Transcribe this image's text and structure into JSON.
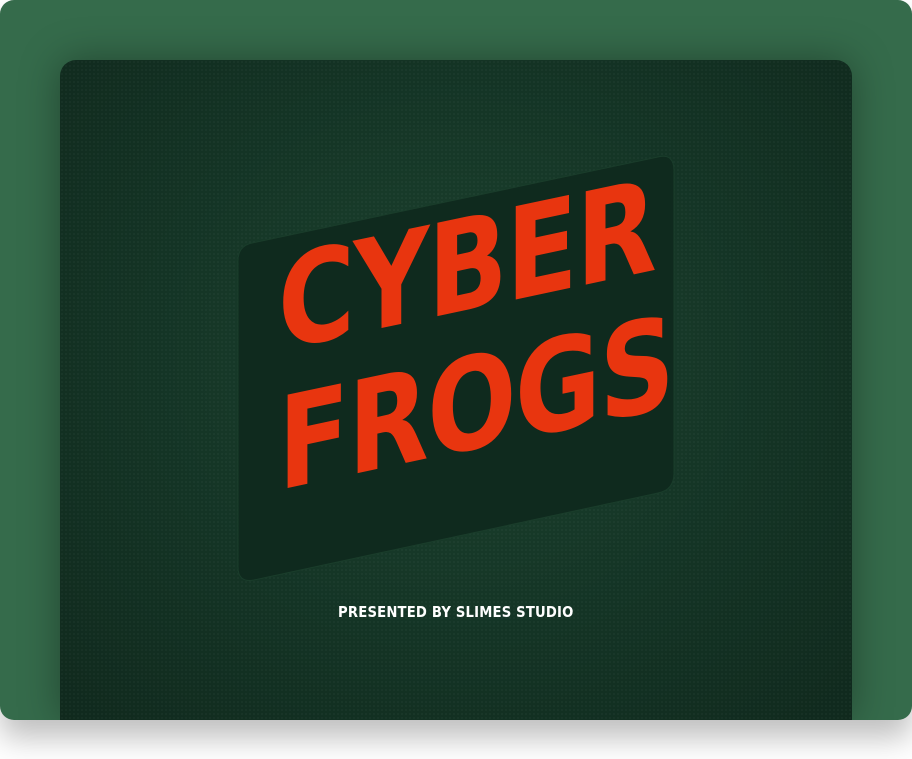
{
  "game": {
    "title_line1": "CYBER",
    "title_line2": "FROGS",
    "subtitle": "PRESENTED BY SLIMES STUDIO"
  },
  "colors": {
    "frame_bg": "#356b4b",
    "screen_bg": "#143425",
    "plate_bg": "#0f2a1e",
    "title": "#e8350f",
    "subtitle": "#ffffff"
  }
}
